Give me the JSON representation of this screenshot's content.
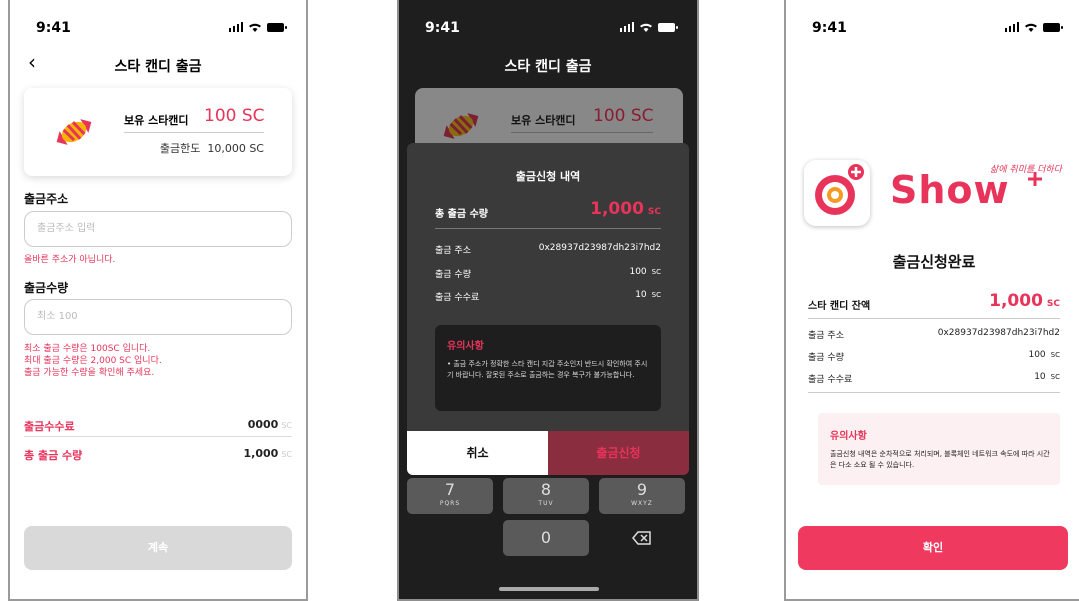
{
  "status": {
    "time": "9:41"
  },
  "screen1": {
    "title": "스타 캔디 출금",
    "hold_label": "보유 스타캔디",
    "hold_value": "100 SC",
    "limit_label": "출금한도",
    "limit_value": "10,000 SC",
    "address_label": "출금주소",
    "address_placeholder": "출금주소 입력",
    "address_error": "올바른 주소가 아닙니다.",
    "amount_label": "출금수량",
    "amount_placeholder": "최소 100",
    "amount_errors": [
      "최소 출금 수량은 100SC 입니다.",
      "최대 출금 수량은 2,000 SC 입니다.",
      "출금 가능한 수량을 확인해 주세요."
    ],
    "fee_label": "출금수수료",
    "fee_value": "0000",
    "fee_unit": "SC",
    "total_label": "총 출금 수량",
    "total_value": "1,000",
    "total_unit": "SC",
    "continue_button": "계속"
  },
  "screen2": {
    "title": "스타 캔디 출금",
    "hold_label": "보유 스타캔디",
    "hold_value": "100 SC",
    "modal_title": "출금신청 내역",
    "total_label": "총 출금 수량",
    "total_value": "1,000",
    "total_unit": "SC",
    "rows": [
      {
        "label": "출금 주소",
        "value": "0x28937d23987dh23i7hd2",
        "unit": ""
      },
      {
        "label": "출금 수량",
        "value": "100",
        "unit": "SC"
      },
      {
        "label": "출금 수수료",
        "value": "10",
        "unit": "SC"
      }
    ],
    "notice_title": "유의사항",
    "notice_body": "• 출금 주소가 정확한 스타 캔디 지갑 주소인지 반드시 확인하여 주시기 바랍니다. 잘못된 주소로 출금하는 경우 복구가 불가능합니다.",
    "cancel_button": "취소",
    "confirm_button": "출금신청",
    "keys": [
      {
        "n": "7",
        "s": "PQRS"
      },
      {
        "n": "8",
        "s": "TUV"
      },
      {
        "n": "9",
        "s": "WXYZ"
      },
      {
        "n": "0",
        "s": ""
      }
    ]
  },
  "screen3": {
    "brand": "Show",
    "tagline": "삶에 취미를 더하다",
    "heading": "출금신청완료",
    "balance_label": "스타 캔디 잔액",
    "balance_value": "1,000",
    "balance_unit": "SC",
    "rows": [
      {
        "label": "출금 주소",
        "value": "0x28937d23987dh23i7hd2",
        "unit": ""
      },
      {
        "label": "출금 수량",
        "value": "100",
        "unit": "SC"
      },
      {
        "label": "출금 수수료",
        "value": "10",
        "unit": "SC"
      }
    ],
    "notice_title": "유의사항",
    "notice_body": "출금신청 내역은 순차적으로 처리되며, 블록체인 네트워크 속도에 따라 시간은 다소 소요 될 수 있습니다.",
    "confirm_button": "확인"
  },
  "colors": {
    "accent": "#e8335a",
    "dark": "#1e1e1e",
    "gray_button": "#d9d9d9"
  }
}
